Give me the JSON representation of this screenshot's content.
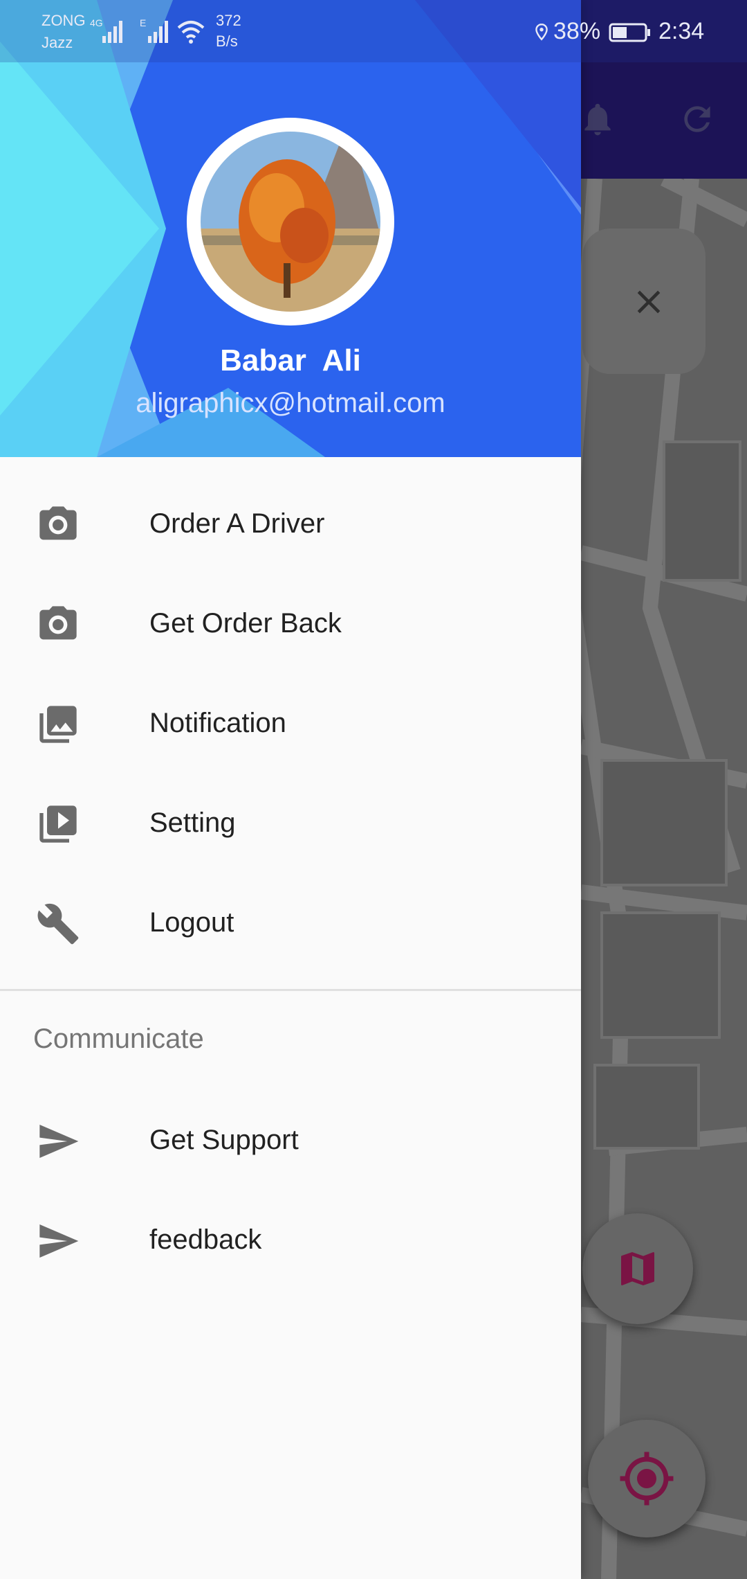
{
  "status_bar": {
    "carrier_primary": "ZONG",
    "carrier_secondary": "Jazz",
    "network_type_1": "4G",
    "network_type_2": "E",
    "net_speed_value": "372",
    "net_speed_unit": "B/s",
    "battery_percent": "38%",
    "time": "2:34"
  },
  "drawer": {
    "header": {
      "user_name": "Babar  Ali",
      "user_email": "aligraphicx@hotmail.com"
    },
    "menu_items": [
      {
        "label": "Order A Driver",
        "icon": "camera-icon"
      },
      {
        "label": "Get Order Back",
        "icon": "camera-icon"
      },
      {
        "label": "Notification",
        "icon": "photo-library-icon"
      },
      {
        "label": "Setting",
        "icon": "video-library-icon"
      },
      {
        "label": "Logout",
        "icon": "wrench-icon"
      }
    ],
    "section_title": "Communicate",
    "section_items": [
      {
        "label": "Get Support",
        "icon": "send-icon"
      },
      {
        "label": "feedback",
        "icon": "send-icon"
      }
    ]
  },
  "background_app": {
    "toolbar_icons": [
      "bell-icon",
      "refresh-icon"
    ],
    "map_buttons": [
      "map-icon",
      "gps-target-icon"
    ],
    "accent_color": "#880e4f",
    "toolbar_color": "#1c1356"
  }
}
